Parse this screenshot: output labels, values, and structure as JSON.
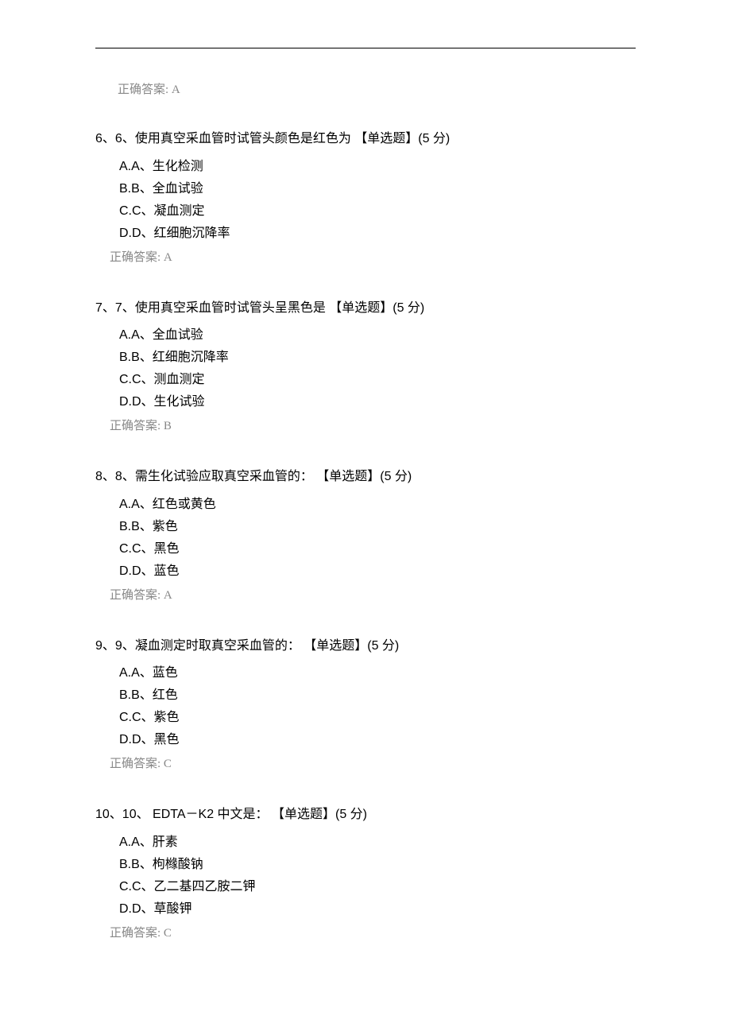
{
  "orphan_answer": "正确答案: A",
  "questions": [
    {
      "number": "6、6、",
      "stem": "使用真空采血管时试管头颜色是红色为 【单选题】(5 分)",
      "options": [
        "A.A、生化检测",
        "B.B、全血试验",
        "C.C、凝血测定",
        "D.D、红细胞沉降率"
      ],
      "answer": "正确答案: A"
    },
    {
      "number": "7、7、",
      "stem": "使用真空采血管时试管头呈黑色是 【单选题】(5 分)",
      "options": [
        "A.A、全血试验",
        "B.B、红细胞沉降率",
        "C.C、测血测定",
        "D.D、生化试验"
      ],
      "answer": "正确答案: B"
    },
    {
      "number": "8、8、",
      "stem": "需生化试验应取真空采血管的： 【单选题】(5 分)",
      "options": [
        "A.A、红色或黄色",
        "B.B、紫色",
        "C.C、黑色",
        "D.D、蓝色"
      ],
      "answer": "正确答案: A"
    },
    {
      "number": "9、9、",
      "stem": "凝血测定时取真空采血管的： 【单选题】(5 分)",
      "options": [
        "A.A、蓝色",
        "B.B、红色",
        "C.C、紫色",
        "D.D、黑色"
      ],
      "answer": "正确答案: C"
    },
    {
      "number": "10、10、",
      "stem": " EDTA－K2 中文是： 【单选题】(5 分)",
      "options": [
        "A.A、肝素",
        "B.B、枸橼酸钠",
        "C.C、乙二基四乙胺二钾",
        "D.D、草酸钾"
      ],
      "answer": "正确答案: C"
    }
  ]
}
